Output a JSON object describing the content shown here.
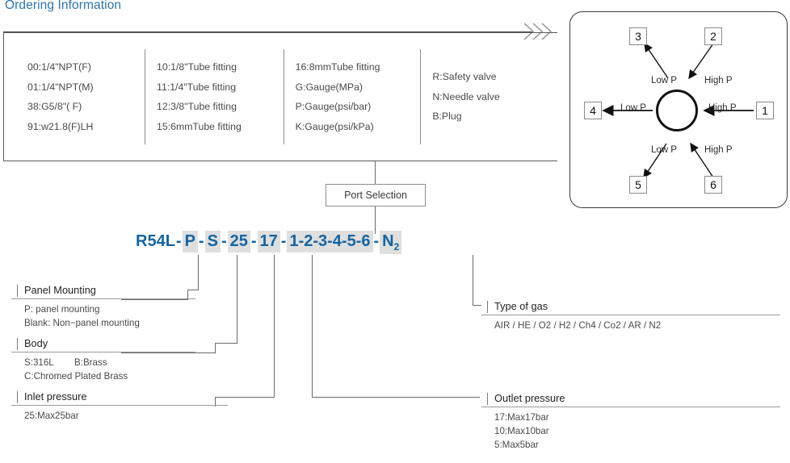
{
  "title": "Ordering Information",
  "options": {
    "columns": [
      {
        "items": [
          "00:1/4\"NPT(F)",
          "01:1/4\"NPT(M)",
          "38:G5/8\"( F)",
          "91:w21.8(F)LH"
        ]
      },
      {
        "items": [
          "10:1/8\"Tube fitting",
          "11:1/4\"Tube fitting",
          "12:3/8\"Tube fitting",
          "15:6mmTube fitting"
        ]
      },
      {
        "items": [
          "16:8mmTube fitting",
          "G:Gauge(MPa)",
          "P:Gauge(psi/bar)",
          "K:Gauge(psi/kPa)"
        ]
      },
      {
        "items": [
          "R:Safety valve",
          "N:Needle valve",
          "B:Plug"
        ]
      }
    ]
  },
  "port_panel": {
    "boxes": [
      {
        "id": "1",
        "label": "High P"
      },
      {
        "id": "2",
        "label": "High P"
      },
      {
        "id": "3",
        "label": "Low P"
      },
      {
        "id": "4",
        "label": "Low P"
      },
      {
        "id": "5",
        "label": "Low P"
      },
      {
        "id": "6",
        "label": "High P"
      }
    ]
  },
  "port_selection": {
    "label": "Port Selection"
  },
  "model_code": {
    "prefix": "R54L",
    "panel": "P",
    "body": "S",
    "inlet": "25",
    "outlet": "17",
    "ports": "1-2-3-4-5-6",
    "gas": "N",
    "gas_sub": "2",
    "dash": "-"
  },
  "callouts": {
    "panel_mounting": {
      "heading": "Panel Mounting",
      "lines": [
        "P: panel mounting",
        "Blank: Non−panel mounting"
      ]
    },
    "body": {
      "heading": "Body",
      "line1_a": "S:316L",
      "line1_b": "B:Brass",
      "line2": "C:Chromed Plated Brass"
    },
    "inlet_pressure": {
      "heading": "Inlet pressure",
      "lines": [
        "25:Max25bar"
      ]
    },
    "type_of_gas": {
      "heading": "Type of gas",
      "lines": [
        "AIR / HE / O2  / H2  / Ch4 / Co2  / AR / N2"
      ]
    },
    "outlet_pressure": {
      "heading": "Outlet pressure",
      "lines": [
        "17:Max17bar",
        "10:Max10bar",
        "5:Max5bar"
      ]
    }
  },
  "colors": {
    "title_blue": "#2e74a8",
    "code_blue": "#1464a0",
    "highlight": "#dfdfdf",
    "line": "#6a6a6a"
  }
}
